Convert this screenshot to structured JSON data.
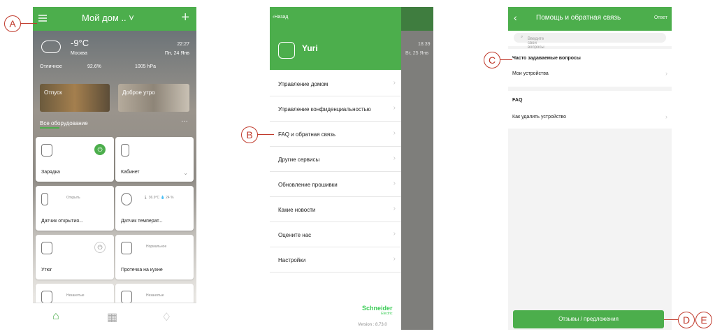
{
  "callouts": [
    "A",
    "B",
    "C",
    "D",
    "E"
  ],
  "colors": {
    "accent": "#4cae4c",
    "callout": "#c0392b"
  },
  "screen1": {
    "title": "Мой дом .. ˅",
    "plus": "+",
    "weather": {
      "temp": "-9°C",
      "city": "Москва",
      "time": "22:27",
      "date": "Пн, 24 Янв",
      "stat1": "Отличное",
      "stat2": "92.6%",
      "stat3": "1005 hPa"
    },
    "scenes": [
      "Отпуск",
      "Доброе утро"
    ],
    "section_title": "Все оборудование",
    "more": "···",
    "cards": [
      {
        "name": "Зарядка",
        "sub": ""
      },
      {
        "name": "Кабинет",
        "sub": ""
      },
      {
        "name": "Датчик открытия...",
        "sub": "Открыть"
      },
      {
        "name": "Датчик температ...",
        "sub": "🌡 36.9°C  💧 24 %"
      },
      {
        "name": "Утюг",
        "sub": ""
      },
      {
        "name": "Протечка на кухне",
        "sub": "Нормальное"
      },
      {
        "name": "",
        "sub": "Незанятые"
      },
      {
        "name": "",
        "sub": "Незанятые"
      }
    ],
    "tabs": [
      "⌂",
      "▦",
      "♢"
    ]
  },
  "screen2": {
    "back": "‹Назад",
    "user": "Yuri",
    "menu": [
      "Управление домом",
      "Управление конфиденциальностью",
      "FAQ и обратная связь",
      "Другие сервисы",
      "Обновление прошивки",
      "Какие новости",
      "Оцените нас",
      "Настройки"
    ],
    "chevron": "›",
    "logo": "Schneider",
    "logo_sub": "Electric",
    "version": "Version : 8.73.0",
    "behind_time": "18:39",
    "behind_date": "Вт, 25 Янв"
  },
  "screen3": {
    "back": "‹",
    "title": "Помощь и обратная связь",
    "reply": "Ответ",
    "search_placeholder": "Введите свои вопросы",
    "faq_title": "Часто задаваемые вопросы",
    "faq_item": "Мои устройства",
    "faq2_title": "FAQ",
    "faq2_item": "Как удалить устройство",
    "chevron": "›",
    "feedback": "Отзывы / предложения"
  }
}
